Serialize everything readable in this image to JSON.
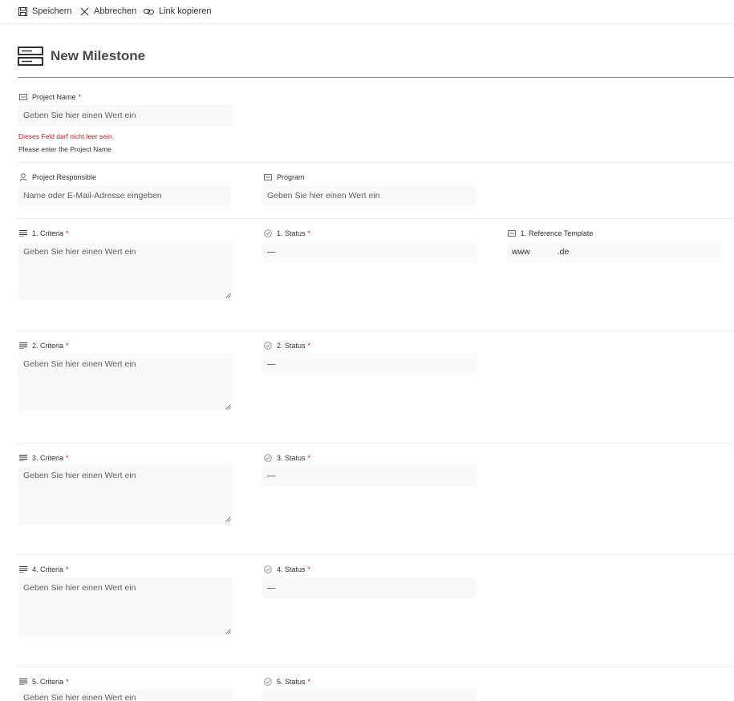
{
  "toolbar": {
    "save_label": "Speichern",
    "cancel_label": "Abbrechen",
    "copy_link_label": "Link kopieren"
  },
  "header": {
    "title": "New Milestone"
  },
  "project_name": {
    "label": "Project Name",
    "placeholder": "Geben Sie hier einen Wert ein",
    "error": "Dieses Feld darf nicht leer sein.",
    "hint": "Please enter the Project Name"
  },
  "project_responsible": {
    "label": "Project Responsible",
    "placeholder": "Name oder E-Mail-Adresse eingeben"
  },
  "program": {
    "label": "Program",
    "placeholder": "Geben Sie hier einen Wert ein"
  },
  "criteria": [
    {
      "label": "1. Criteria",
      "placeholder": "Geben Sie hier einen Wert ein"
    },
    {
      "label": "2. Criteria",
      "placeholder": "Geben Sie hier einen Wert ein"
    },
    {
      "label": "3. Criteria",
      "placeholder": "Geben Sie hier einen Wert ein"
    },
    {
      "label": "4. Criteria",
      "placeholder": "Geben Sie hier einen Wert ein"
    },
    {
      "label": "5. Criteria",
      "placeholder": "Geben Sie hier einen Wert ein"
    }
  ],
  "status": [
    {
      "label": "1. Status",
      "value": "—"
    },
    {
      "label": "2. Status",
      "value": "—"
    },
    {
      "label": "3. Status",
      "value": "—"
    },
    {
      "label": "4. Status",
      "value": "—"
    },
    {
      "label": "5. Status",
      "value": ""
    }
  ],
  "reference_template": {
    "label": "1. Reference Template",
    "value_prefix": "www",
    "value_suffix": ".de"
  },
  "required_marker": "*",
  "icons": {
    "save": "save-icon",
    "cancel": "close-icon",
    "link": "link-icon",
    "list": "list-icon",
    "text_field": "text-field-icon",
    "person": "person-icon",
    "multiline": "multiline-text-icon",
    "status": "check-circle-icon"
  },
  "colors": {
    "error": "#a4262c",
    "field_bg": "#faf9f8",
    "separator": "#edebe9",
    "header_rule": "#8a8886"
  }
}
